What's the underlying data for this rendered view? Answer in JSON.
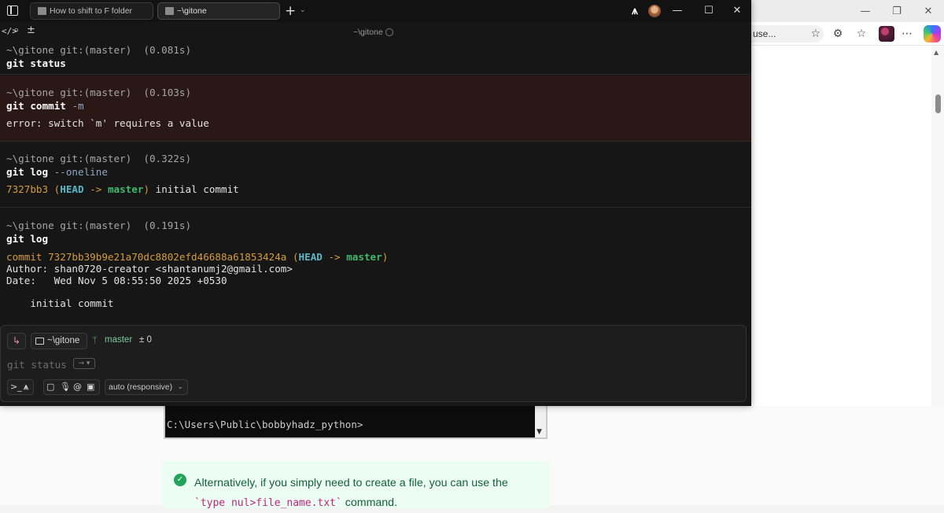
{
  "terminal": {
    "tabs": [
      {
        "label": "How to shift to F folder"
      },
      {
        "label": "~\\gitone"
      }
    ],
    "center_title": "~\\gitone",
    "blocks": [
      {
        "prompt": "~\\gitone git:(master)  (0.081s)",
        "command": "git status"
      },
      {
        "prompt": "~\\gitone git:(master)  (0.103s)",
        "command_kw1": "git",
        "command_kw2": "commit",
        "command_flag": "-m",
        "output": "error: switch `m' requires a value"
      },
      {
        "prompt": "~\\gitone git:(master)  (0.322s)",
        "command_kw1": "git",
        "command_kw2": "log",
        "command_flag": "--oneline",
        "output_hash": "7327bb3",
        "output_open": " (",
        "output_head": "HEAD",
        "output_arrow": " -> ",
        "output_branch": "master",
        "output_close": ")",
        "output_msg": " initial commit"
      },
      {
        "prompt": "~\\gitone git:(master)  (0.191s)",
        "command_kw1": "git",
        "command_kw2": "log",
        "commit_label": "commit 7327bb39b9e21a70dc8802efd46688a61853424a",
        "commit_open": " (",
        "commit_head": "HEAD",
        "commit_arrow": " -> ",
        "commit_branch": "master",
        "commit_close": ")",
        "author": "Author: shan0720-creator <shantanumj2@gmail.com>",
        "date": "Date:   Wed Nov 5 08:55:50 2025 +0530",
        "message": "    initial commit"
      }
    ],
    "input": {
      "cwd": "~\\gitone",
      "branch": "master",
      "diff": "± 0",
      "placeholder": "git status",
      "ghost_key": "→ ▾",
      "model": "auto (responsive)"
    }
  },
  "browser": {
    "address_tail": "use...",
    "console_line": "C:\\Users\\Public\\bobbyhadz_python>",
    "tip_line1": "Alternatively, if you simply need to create a file, you can use the",
    "tip_code": "`type nul>file_name.txt`",
    "tip_line2_suffix": " command."
  },
  "colors": {
    "terminal_bg": "#161616",
    "error_block_bg": "#2a1816",
    "hash": "#d49c3d",
    "head": "#58b7c7",
    "branch": "#3fb96c",
    "tip_bg": "#ecfdf3",
    "tip_text": "#14613a"
  }
}
